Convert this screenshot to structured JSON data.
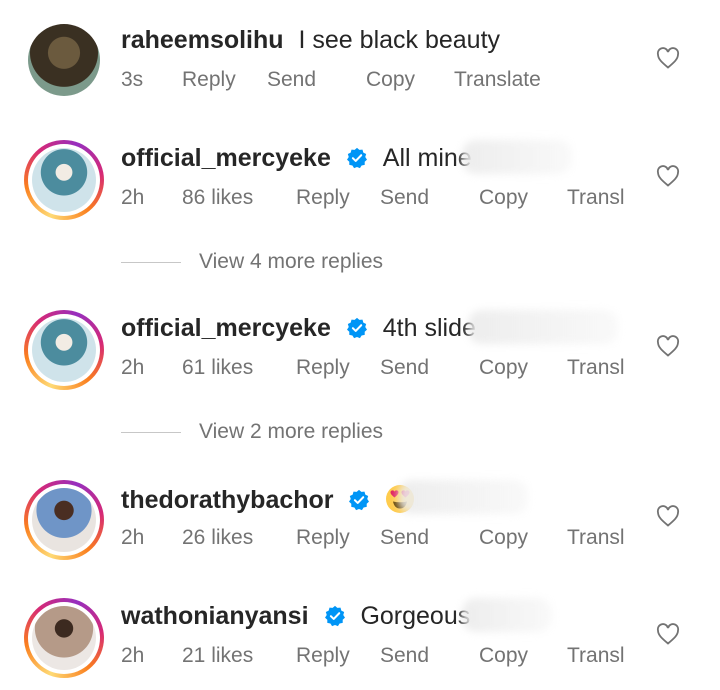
{
  "comments": [
    {
      "username": "raheemsolihu",
      "verified": false,
      "text": "I see black beauty",
      "time": "3s",
      "likes": "",
      "actions": [
        "Reply",
        "Send",
        "Copy",
        "Translate"
      ]
    },
    {
      "username": "official_mercyeke",
      "verified": true,
      "text": "All mine",
      "time": "2h",
      "likes": "86 likes",
      "actions": [
        "Reply",
        "Send",
        "Copy",
        "Transl"
      ]
    },
    {
      "username": "official_mercyeke",
      "verified": true,
      "text": "4th slide",
      "time": "2h",
      "likes": "61 likes",
      "actions": [
        "Reply",
        "Send",
        "Copy",
        "Transl"
      ]
    },
    {
      "username": "thedorathybachor",
      "verified": true,
      "text": "",
      "emoji": "heart-eyes-emoji",
      "time": "2h",
      "likes": "26 likes",
      "actions": [
        "Reply",
        "Send",
        "Copy",
        "Transl"
      ]
    },
    {
      "username": "wathonianyansi",
      "verified": true,
      "text": "Gorgeous",
      "time": "2h",
      "likes": "21 likes",
      "actions": [
        "Reply",
        "Send",
        "Copy",
        "Transl"
      ]
    }
  ],
  "view_replies": [
    "View 4 more replies",
    "View 2 more replies"
  ],
  "colors": {
    "verified": "#0095f6",
    "text": "#262626",
    "meta": "#737373"
  }
}
